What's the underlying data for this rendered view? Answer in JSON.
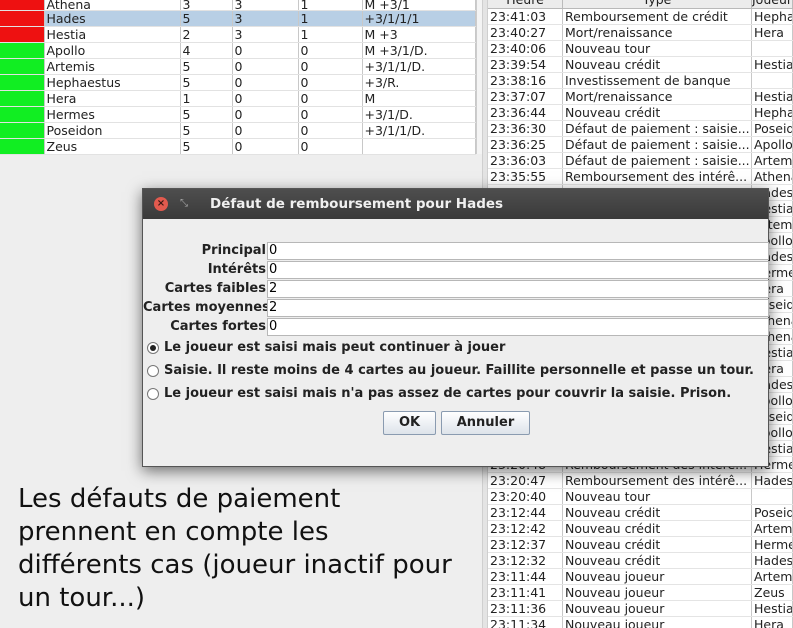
{
  "players": [
    {
      "status": "#ee1111",
      "name": "Athena",
      "v1": "3",
      "v2": "3",
      "v3": "1",
      "v4": "M +3/1"
    },
    {
      "status": "#ee1111",
      "name": "Hades",
      "v1": "5",
      "v2": "3",
      "v3": "1",
      "v4": "+3/1/1/1",
      "selected": true
    },
    {
      "status": "#ee1111",
      "name": "Hestia",
      "v1": "2",
      "v2": "3",
      "v3": "1",
      "v4": "M +3"
    },
    {
      "status": "#11ee22",
      "name": "Apollo",
      "v1": "4",
      "v2": "0",
      "v3": "0",
      "v4": "M +3/1/D."
    },
    {
      "status": "#11ee22",
      "name": "Artemis",
      "v1": "5",
      "v2": "0",
      "v3": "0",
      "v4": "+3/1/1/D."
    },
    {
      "status": "#11ee22",
      "name": "Hephaestus",
      "v1": "5",
      "v2": "0",
      "v3": "0",
      "v4": "+3/R."
    },
    {
      "status": "#11ee22",
      "name": "Hera",
      "v1": "1",
      "v2": "0",
      "v3": "0",
      "v4": "M"
    },
    {
      "status": "#11ee22",
      "name": "Hermes",
      "v1": "5",
      "v2": "0",
      "v3": "0",
      "v4": "+3/1/D."
    },
    {
      "status": "#11ee22",
      "name": "Poseidon",
      "v1": "5",
      "v2": "0",
      "v3": "0",
      "v4": "+3/1/1/D."
    },
    {
      "status": "#11ee22",
      "name": "Zeus",
      "v1": "5",
      "v2": "0",
      "v3": "0",
      "v4": ""
    }
  ],
  "log": {
    "headers": {
      "time": "Heure",
      "type": "Type",
      "player": "Joueur"
    },
    "rows": [
      {
        "time": "23:41:03",
        "type": "Remboursement de crédit",
        "player": "Hephaestus"
      },
      {
        "time": "23:40:27",
        "type": "Mort/renaissance",
        "player": "Hera"
      },
      {
        "time": "23:40:06",
        "type": "Nouveau tour",
        "player": ""
      },
      {
        "time": "23:39:54",
        "type": "Nouveau crédit",
        "player": "Hestia"
      },
      {
        "time": "23:38:16",
        "type": "Investissement de banque",
        "player": ""
      },
      {
        "time": "23:37:07",
        "type": "Mort/renaissance",
        "player": "Hestia"
      },
      {
        "time": "23:36:44",
        "type": "Nouveau crédit",
        "player": "Hephaestus"
      },
      {
        "time": "23:36:30",
        "type": "Défaut de paiement : saisie...",
        "player": "Poseidon"
      },
      {
        "time": "23:36:25",
        "type": "Défaut de paiement : saisie...",
        "player": "Apollo"
      },
      {
        "time": "23:36:03",
        "type": "Défaut de paiement : saisie...",
        "player": "Artemis"
      },
      {
        "time": "23:35:55",
        "type": "Remboursement des intérê...",
        "player": "Athena"
      },
      {
        "time": "",
        "type": "",
        "player": "Hades"
      },
      {
        "time": "",
        "type": "",
        "player": "Hestia"
      },
      {
        "time": "",
        "type": "",
        "player": "Artemis"
      },
      {
        "time": "",
        "type": "",
        "player": "Apollo"
      },
      {
        "time": "",
        "type": "",
        "player": "Hades"
      },
      {
        "time": "",
        "type": "",
        "player": "Hermes"
      },
      {
        "time": "",
        "type": "",
        "player": "Hera"
      },
      {
        "time": "",
        "type": "",
        "player": "Poseidon"
      },
      {
        "time": "",
        "type": "",
        "player": "Athena"
      },
      {
        "time": "",
        "type": "",
        "player": "Athena"
      },
      {
        "time": "",
        "type": "",
        "player": "Hestia"
      },
      {
        "time": "",
        "type": "",
        "player": "Hera"
      },
      {
        "time": "",
        "type": "",
        "player": "Hades"
      },
      {
        "time": "",
        "type": "",
        "player": "Apollo"
      },
      {
        "time": "",
        "type": "",
        "player": "Poseidon"
      },
      {
        "time": "",
        "type": "",
        "player": "Apollo"
      },
      {
        "time": "",
        "type": "",
        "player": "Hestia"
      },
      {
        "time": "23:20:48",
        "type": "Remboursement des intérê...",
        "player": "Hermes"
      },
      {
        "time": "23:20:47",
        "type": "Remboursement des intérê...",
        "player": "Hades"
      },
      {
        "time": "23:20:40",
        "type": "Nouveau tour",
        "player": ""
      },
      {
        "time": "23:12:44",
        "type": "Nouveau crédit",
        "player": "Poseidon"
      },
      {
        "time": "23:12:42",
        "type": "Nouveau crédit",
        "player": "Artemis"
      },
      {
        "time": "23:12:37",
        "type": "Nouveau crédit",
        "player": "Hermes"
      },
      {
        "time": "23:12:32",
        "type": "Nouveau crédit",
        "player": "Hades"
      },
      {
        "time": "23:11:44",
        "type": "Nouveau joueur",
        "player": "Artemis"
      },
      {
        "time": "23:11:41",
        "type": "Nouveau joueur",
        "player": "Zeus"
      },
      {
        "time": "23:11:36",
        "type": "Nouveau joueur",
        "player": "Hestia"
      },
      {
        "time": "23:11:34",
        "type": "Nouveau joueur",
        "player": "Hera"
      }
    ]
  },
  "dialog": {
    "title": "Défaut de remboursement pour Hades",
    "fields": [
      {
        "label": "Principal",
        "value": "0"
      },
      {
        "label": "Intérêts",
        "value": "0"
      },
      {
        "label": "Cartes faibles",
        "value": "2"
      },
      {
        "label": "Cartes moyennes",
        "value": "2"
      },
      {
        "label": "Cartes fortes",
        "value": "0"
      }
    ],
    "options": [
      {
        "label": "Le joueur est saisi mais peut continuer à jouer",
        "checked": true
      },
      {
        "label": "Saisie. Il reste moins de 4 cartes au joueur. Faillite personnelle et passe un tour.",
        "checked": false
      },
      {
        "label": "Le joueur est saisi mais n'a pas assez de cartes pour couvrir la saisie. Prison.",
        "checked": false
      }
    ],
    "ok_label": "OK",
    "cancel_label": "Annuler"
  },
  "caption": "Les défauts de paiement prennent en compte les différents cas (joueur inactif pour un tour...)"
}
